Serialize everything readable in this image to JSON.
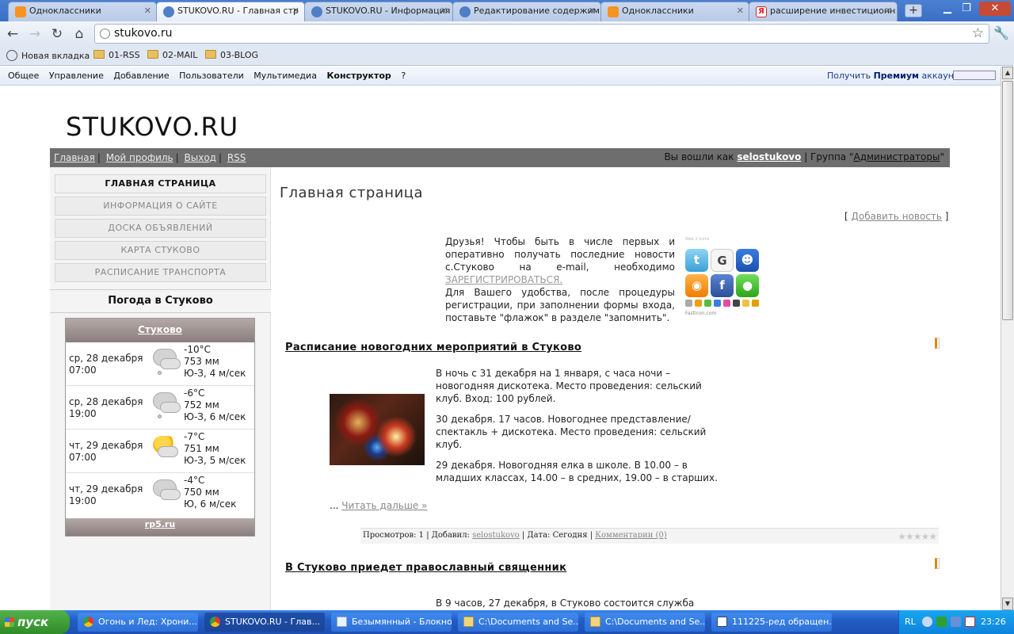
{
  "browser": {
    "tabs": [
      {
        "title": "Одноклассники",
        "icon": "odnoklassniki-icon",
        "active": false
      },
      {
        "title": "STUKOVO.RU - Главная стр",
        "icon": "stukovo-icon",
        "active": true
      },
      {
        "title": "STUKOVO.RU - Информация",
        "icon": "stukovo-icon",
        "active": false
      },
      {
        "title": "Редактирование содержим",
        "icon": "stukovo-icon",
        "active": false
      },
      {
        "title": "Одноклассники",
        "icon": "odnoklassniki-icon",
        "active": false
      },
      {
        "title": "расширение инвестиционн",
        "icon": "yandex-icon",
        "active": false
      }
    ],
    "url": "stukovo.ru",
    "bookmarks": [
      {
        "label": "Новая вкладка",
        "type": "page"
      },
      {
        "label": "01-RSS",
        "type": "folder"
      },
      {
        "label": "02-MAIL",
        "type": "folder"
      },
      {
        "label": "03-BLOG",
        "type": "folder"
      }
    ]
  },
  "adminbar": {
    "menu": [
      "Общее",
      "Управление",
      "Добавление",
      "Пользователи",
      "Мультимедиа",
      "Конструктор",
      "?"
    ],
    "premium_prefix": "Получить",
    "premium_bold": "Премиум",
    "premium_suffix": "аккаунт"
  },
  "site": {
    "title": "STUKOVO.RU",
    "topnav": [
      "Главная",
      "Мой профиль",
      "Выход",
      "RSS"
    ],
    "logged_prefix": "Вы вошли как",
    "username": "selostukovo",
    "group_prefix": "| Группа \"",
    "group": "Администраторы",
    "group_suffix": "\""
  },
  "sidebar": {
    "menu": [
      "ГЛАВНАЯ СТРАНИЦА",
      "ИНФОРМАЦИЯ О САЙТЕ",
      "ДОСКА ОБЪЯВЛЕНИЙ",
      "КАРТА СТУКОВО",
      "РАСПИСАНИЕ ТРАНСПОРТА"
    ],
    "weather_title": "Погода в Стуково",
    "weather_city": "Стуково",
    "weather_source": "rp5.ru",
    "forecast": [
      {
        "date": "ср, 28 декабря",
        "time": "07:00",
        "temp": "-10°C",
        "pressure": "753 мм",
        "wind": "Ю-З, 4 м/сек",
        "icon": "cloud-snow-icon"
      },
      {
        "date": "ср, 28 декабря",
        "time": "19:00",
        "temp": "-6°C",
        "pressure": "752 мм",
        "wind": "Ю-З, 6 м/сек",
        "icon": "cloud-snow-icon"
      },
      {
        "date": "чт, 29 декабря",
        "time": "07:00",
        "temp": "-7°C",
        "pressure": "751 мм",
        "wind": "Ю-З, 5 м/сек",
        "icon": "sun-cloud-icon"
      },
      {
        "date": "чт, 29 декабря",
        "time": "19:00",
        "temp": "-4°C",
        "pressure": "750 мм",
        "wind": "Ю, 6 м/сек",
        "icon": "cloud-icon"
      }
    ]
  },
  "main": {
    "heading": "Главная страница",
    "add_news": "Добавить новость",
    "intro_lead": "Друзья! Чтобы быть в числе первых и оперативно получать последние новости с.Стуково на e-mail, необходимо",
    "intro_link": "ЗАРЕГИСТРИРОВАТЬСЯ.",
    "intro_tail": "Для Вашего удобства, после процедуры регистрации, при заполнении формы входа, поставьте \"флажок\" в разделе \"запомнить\".",
    "social_caption": "Web 2 Icons",
    "social_credit": "Fasticon.com",
    "news": [
      {
        "title": "Расписание новогодних мероприятий в Стуково",
        "paragraphs": [
          "В ночь с 31 декабря на 1 января, с часа ночи – новогодняя дискотека. Место проведения: сельский клуб. Вход: 100 рублей.",
          "30 декабря. 17 часов. Новогоднее представление/спектакль + дискотека. Место проведения: сельский клуб.",
          "29 декабря. Новогодняя елка в школе. В 10.00 – в младших классах, 14.00 – в средних, 19.00 – в старших."
        ],
        "read_more_prefix": "...",
        "read_more": "Читать дальше »",
        "views": "Просмотров: 1",
        "added_by_label": "Добавил:",
        "added_by": "selostukovo",
        "date": "Дата: Сегодня",
        "comments": "Комментарии (0)",
        "rating": 0
      },
      {
        "title": "В Стуково приедет православный священник",
        "text": "В 9 часов, 27 декабря, в Стуково состоится служба"
      }
    ]
  },
  "taskbar": {
    "start": "пуск",
    "tasks": [
      {
        "label": "Огонь и Лед: Хрони...",
        "icon": "chrome-icon",
        "active": false
      },
      {
        "label": "STUKOVO.RU - Глав...",
        "icon": "chrome-icon",
        "active": true
      },
      {
        "label": "Безымянный - Блокнот",
        "icon": "notepad-icon",
        "active": false
      },
      {
        "label": "C:\\Documents and Se...",
        "icon": "folder-icon",
        "active": false
      },
      {
        "label": "C:\\Documents and Se...",
        "icon": "folder-icon",
        "active": false
      },
      {
        "label": "111225-ред обращен...",
        "icon": "word-icon",
        "active": false
      }
    ],
    "lang": "RL",
    "clock": "23:26"
  }
}
